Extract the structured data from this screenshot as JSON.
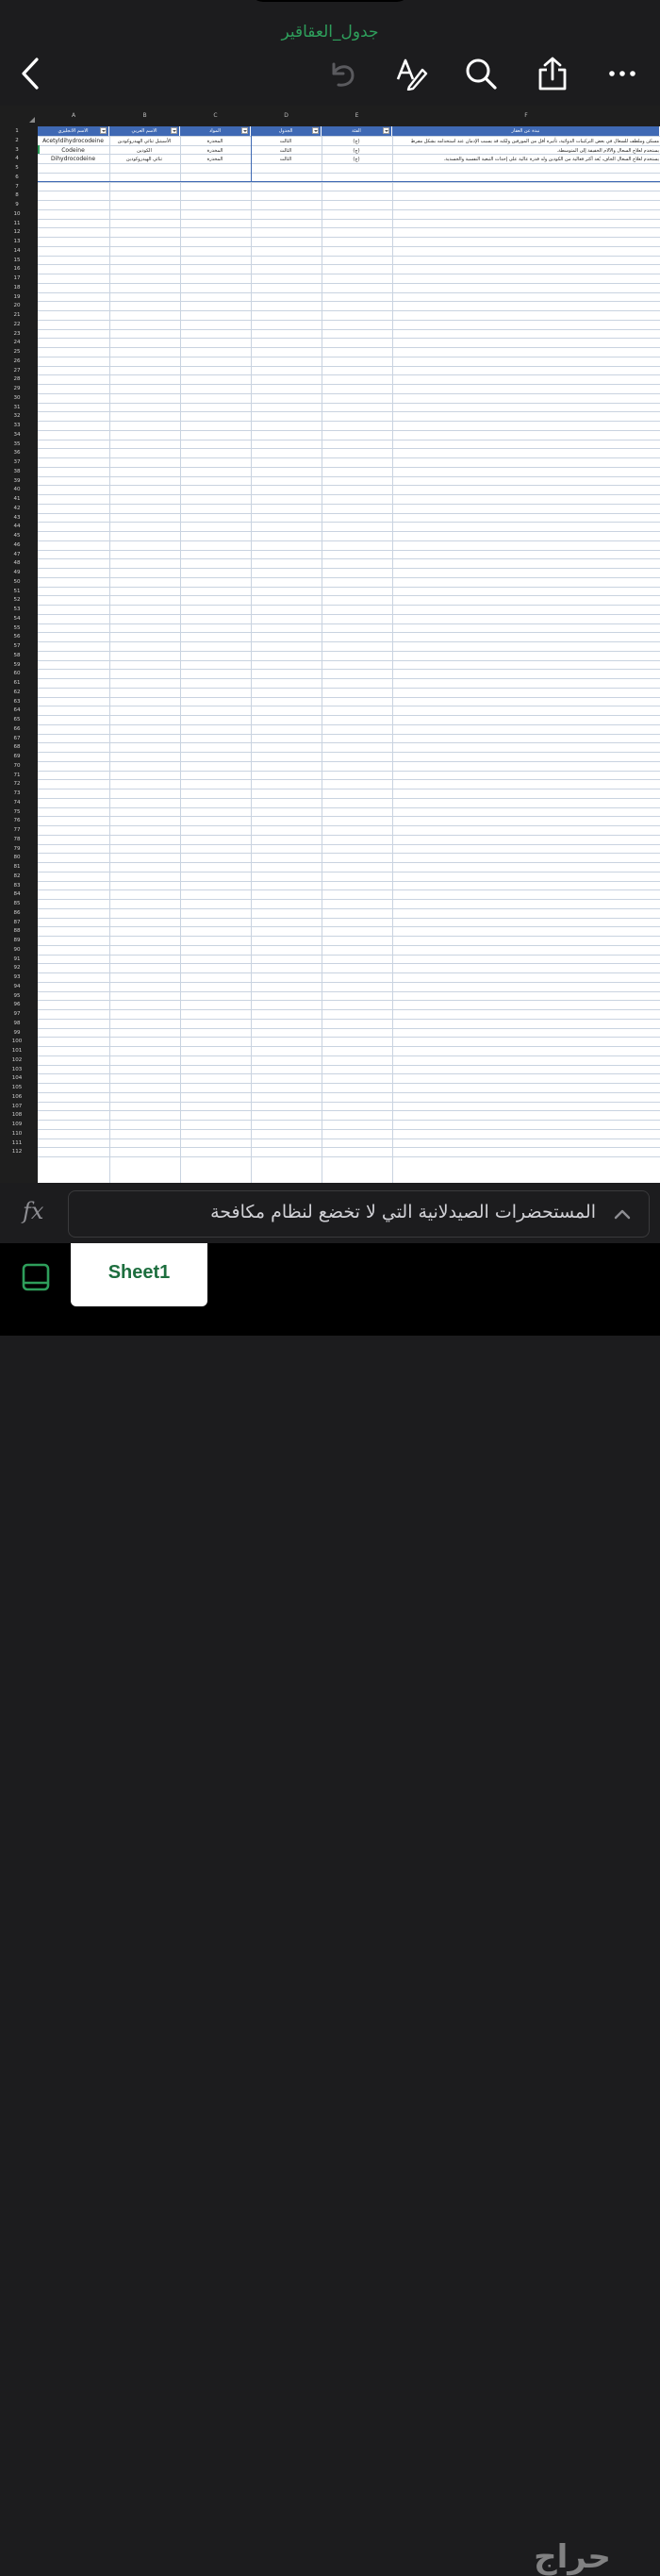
{
  "app": {
    "doc_title": "جدول_العقاقير"
  },
  "toolbar": {
    "back_icon": "chevron-left-icon",
    "undo_icon": "undo-icon",
    "format_icon": "text-format-icon",
    "search_icon": "search-icon",
    "share_icon": "share-icon",
    "more_icon": "more-icon"
  },
  "grid": {
    "columns": [
      "A",
      "B",
      "C",
      "D",
      "E",
      "F"
    ],
    "row_count": 112,
    "headers": [
      "الاسم الانجليزي",
      "الاسم العربي",
      "المواد",
      "الجدول",
      "الفئة",
      "نبذة عن العقار"
    ],
    "rows": [
      [
        "Acetyldihydrocodeine",
        "الأسيتيل ثنائي الهيدروكودين",
        "المخدرة",
        "الثالث",
        "(ج)",
        "مسكن وملطف للسعال في بعض التركيبات الدوائية، تأثيره أقل من المورفين ولكنه قد يسبب الإدمان عند استخدامه بشكل مفرط"
      ],
      [
        "Codeine",
        "الكودين",
        "المخدرة",
        "الثالث",
        "(ج)",
        "يستخدم لعلاج السعال والآلام الخفيفة إلى المتوسطة."
      ],
      [
        "Dihydrocodeine",
        "ثنائي الهيدروكودين",
        "المخدرة",
        "الثالث",
        "(ج)",
        "يستخدم لعلاج السعال الجاف، يُعد أكثر فعالية من الكودين وله قدرة عالية على إحداث التبعية النفسية والجسدية."
      ]
    ]
  },
  "formula_bar": {
    "fx_label": "fx",
    "content": "المستحضرات الصيدلانية التي لا تخضع لنظام مكافحة"
  },
  "tabs": {
    "sheet1": "Sheet1"
  },
  "watermark": "حراج",
  "colors": {
    "accent": "#2e9e5b",
    "header_blue": "#3f69b4",
    "grid_line": "#c9d3e0"
  }
}
